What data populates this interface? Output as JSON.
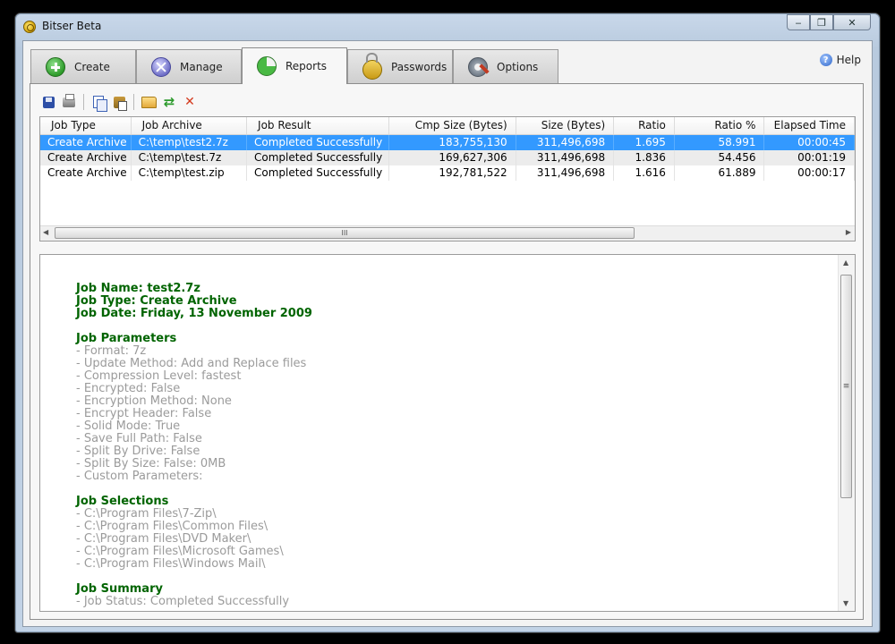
{
  "window": {
    "title": "Bitser Beta",
    "min_glyph": "‒",
    "max_glyph": "❐",
    "close_glyph": "✕"
  },
  "tabs": [
    {
      "label": "Create",
      "icon": "plus-circle-icon"
    },
    {
      "label": "Manage",
      "icon": "manage-icon"
    },
    {
      "label": "Reports",
      "icon": "pie-chart-icon"
    },
    {
      "label": "Passwords",
      "icon": "lock-icon"
    },
    {
      "label": "Options",
      "icon": "wrench-icon"
    }
  ],
  "active_tab": "Reports",
  "help": {
    "label": "Help",
    "glyph": "?"
  },
  "toolbar": {
    "icons": [
      "save-icon",
      "print-icon",
      "copy-icon",
      "paste-icon",
      "open-folder-icon",
      "refresh-icon",
      "delete-icon"
    ],
    "refresh_glyph": "⇄",
    "delete_glyph": "✕"
  },
  "grid": {
    "columns": [
      "Job Type",
      "Job Archive",
      "Job Result",
      "Cmp Size (Bytes)",
      "Size (Bytes)",
      "Ratio",
      "Ratio %",
      "Elapsed Time"
    ],
    "rows": [
      [
        "Create Archive",
        "C:\\temp\\test2.7z",
        "Completed Successfully",
        "183,755,130",
        "311,496,698",
        "1.695",
        "58.991",
        "00:00:45"
      ],
      [
        "Create Archive",
        "C:\\temp\\test.7z",
        "Completed Successfully",
        "169,627,306",
        "311,496,698",
        "1.836",
        "54.456",
        "00:01:19"
      ],
      [
        "Create Archive",
        "C:\\temp\\test.zip",
        "Completed Successfully",
        "192,781,522",
        "311,496,698",
        "1.616",
        "61.889",
        "00:00:17"
      ]
    ],
    "selected_row": 0,
    "scroll": {
      "left_glyph": "◀",
      "right_glyph": "▶",
      "grip_glyph": "III"
    }
  },
  "report": {
    "header": [
      "Job Name: test2.7z",
      "Job Type: Create Archive",
      "Job Date: Friday, 13 November 2009"
    ],
    "parameters_title": "Job Parameters",
    "parameters": [
      "- Format: 7z",
      "- Update Method: Add and Replace files",
      "- Compression Level: fastest",
      "- Encrypted: False",
      "- Encryption Method: None",
      "- Encrypt Header: False",
      "- Solid Mode: True",
      "- Save Full Path: False",
      "- Split By Drive: False",
      "- Split By Size: False: 0MB",
      "- Custom Parameters:"
    ],
    "selections_title": "Job Selections",
    "selections": [
      "- C:\\Program Files\\7-Zip\\",
      "- C:\\Program Files\\Common Files\\",
      "- C:\\Program Files\\DVD Maker\\",
      "- C:\\Program Files\\Microsoft Games\\",
      "- C:\\Program Files\\Windows Mail\\"
    ],
    "summary_title": "Job Summary",
    "summary": [
      "- Job Status: Completed Successfully"
    ],
    "scroll": {
      "up_glyph": "▲",
      "down_glyph": "▼",
      "grip_glyph": "≡"
    }
  },
  "colors": {
    "selection": "#3399ff",
    "report_heading": "#006400",
    "report_text": "#9b9b9b"
  }
}
